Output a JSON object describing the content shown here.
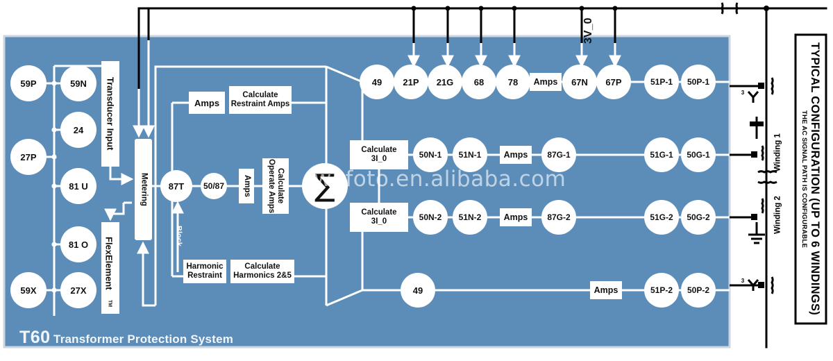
{
  "meta": {
    "watermark": "wofoto.en.alibaba.com",
    "colors": {
      "panel_blue": "#5b8db8",
      "panel_border": "#cfd8de",
      "node_white": "#ffffff",
      "wire_white": "#ffffff",
      "wire_black": "#000000",
      "text_dark": "#111111"
    }
  },
  "brand": {
    "model": "T60",
    "name": "Transformer Protection System"
  },
  "right_panel": {
    "title": "TYPICAL CONFIGURATION (UP TO 6 WINDINGS)",
    "subtitle": "THE AC SIGNAL PATH IS CONFIGURABLE"
  },
  "voltage_elements": {
    "column_a": [
      {
        "label": "59P"
      },
      {
        "label": "27P"
      },
      {
        "label": "59X"
      }
    ],
    "column_b": [
      {
        "label": "59N"
      },
      {
        "label": "24"
      },
      {
        "label": "81 U"
      },
      {
        "label": "81 O"
      },
      {
        "label": "27X"
      }
    ]
  },
  "input_blocks": {
    "transducer": "Transducer Input",
    "flexelement": "FlexElement",
    "flexelement_mark": "TM",
    "metering": "Metering"
  },
  "differential": {
    "element_87t": "87T",
    "element_5087": "50/87",
    "amps_operate": "Amps",
    "calc_operate": "Calculate\nOperate Amps",
    "amps_restraint": "Amps",
    "calc_restraint": "Calculate\nRestraint Amps",
    "harmonic_restraint": "Harmonic\nRestraint",
    "calc_harmonics": "Calculate\nHarmonics 2&5",
    "block_label": "Block",
    "summation": "∑"
  },
  "top_bus": {
    "label_3v0": "3V_0"
  },
  "rows": [
    {
      "id": "winding-1-phase",
      "items": [
        {
          "type": "circle",
          "label": "49"
        },
        {
          "type": "circle",
          "label": "21P"
        },
        {
          "type": "circle",
          "label": "21G"
        },
        {
          "type": "circle",
          "label": "68"
        },
        {
          "type": "circle",
          "label": "78"
        },
        {
          "type": "box",
          "label": "Amps"
        },
        {
          "type": "circle",
          "label": "67N"
        },
        {
          "type": "circle",
          "label": "67P"
        },
        {
          "type": "circle",
          "label": "51P-1"
        },
        {
          "type": "circle",
          "label": "50P-1"
        }
      ]
    },
    {
      "id": "winding-1-ground",
      "items": [
        {
          "type": "box2",
          "label": "Calculate\n3I_0"
        },
        {
          "type": "circle",
          "label": "50N-1"
        },
        {
          "type": "circle",
          "label": "51N-1"
        },
        {
          "type": "box",
          "label": "Amps"
        },
        {
          "type": "circle",
          "label": "87G-1"
        },
        {
          "type": "circle",
          "label": "51G-1"
        },
        {
          "type": "circle",
          "label": "50G-1"
        }
      ]
    },
    {
      "id": "winding-2-ground",
      "items": [
        {
          "type": "box2",
          "label": "Calculate\n3I_0"
        },
        {
          "type": "circle",
          "label": "50N-2"
        },
        {
          "type": "circle",
          "label": "51N-2"
        },
        {
          "type": "box",
          "label": "Amps"
        },
        {
          "type": "circle",
          "label": "87G-2"
        },
        {
          "type": "circle",
          "label": "51G-2"
        },
        {
          "type": "circle",
          "label": "50G-2"
        }
      ]
    },
    {
      "id": "winding-2-phase",
      "items": [
        {
          "type": "circle",
          "label": "49"
        },
        {
          "type": "box",
          "label": "Amps"
        },
        {
          "type": "circle",
          "label": "51P-2"
        },
        {
          "type": "circle",
          "label": "50P-2"
        }
      ]
    }
  ],
  "single_line": {
    "winding_1": "Winding 1",
    "winding_2": "Winding 2",
    "ct_phase_count": "3"
  }
}
